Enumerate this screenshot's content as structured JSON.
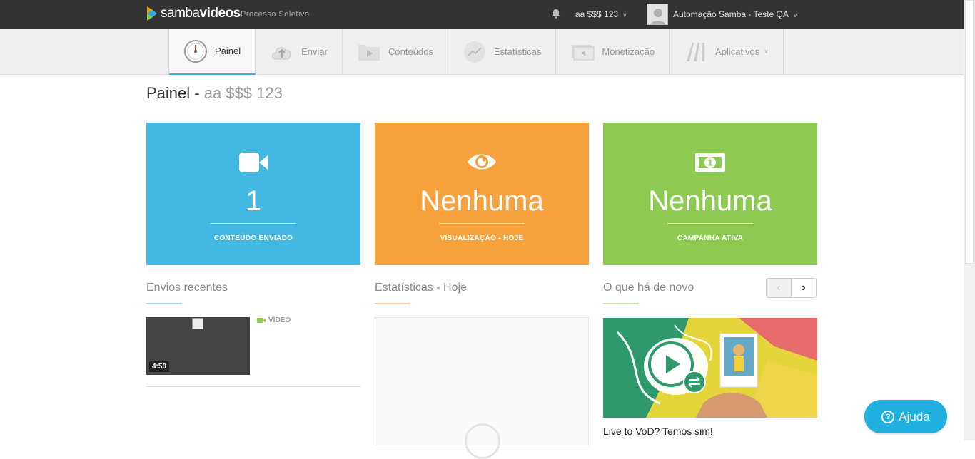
{
  "topbar": {
    "logo_light": "samba",
    "logo_bold": "videos",
    "subtitle": "Processo Seletivo",
    "account": "aa $$$ 123",
    "user": "Automação Samba - Teste QA"
  },
  "nav": {
    "items": [
      {
        "label": "Painel",
        "icon": "gauge-icon"
      },
      {
        "label": "Enviar",
        "icon": "cloud-upload-icon"
      },
      {
        "label": "Conteúdos",
        "icon": "folder-video-icon"
      },
      {
        "label": "Estatísticas",
        "icon": "stats-chart-icon"
      },
      {
        "label": "Monetização",
        "icon": "money-icon"
      },
      {
        "label": "Aplicativos",
        "icon": "apps-icon"
      }
    ]
  },
  "page": {
    "title": "Painel",
    "separator": " - ",
    "account": "aa $$$ 123"
  },
  "cards": [
    {
      "value": "1",
      "label": "CONTEÚDO ENVIADO",
      "icon": "video-camera-icon",
      "color": "#42b8e3"
    },
    {
      "value": "Nenhuma",
      "label": "VISUALIZAÇÃO - HOJE",
      "icon": "eye-icon",
      "color": "#f8a23d"
    },
    {
      "value": "Nenhuma",
      "label": "CAMPANHA ATIVA",
      "icon": "banknote-icon",
      "color": "#8ec952"
    }
  ],
  "sections": {
    "recent": "Envios recentes",
    "stats": "Estatísticas - Hoje",
    "news": "O que há de novo"
  },
  "recent_item": {
    "duration": "4:50",
    "type": "VÍDEO"
  },
  "news_item": {
    "caption": "Live to VoD? Temos sim!"
  },
  "help": {
    "label": "Ajuda"
  },
  "colors": {
    "topbar": "#333333",
    "accent": "#3aa8d8",
    "blue": "#42b8e3",
    "orange": "#f8a23d",
    "green": "#8ec952",
    "help": "#1fb0e0"
  }
}
